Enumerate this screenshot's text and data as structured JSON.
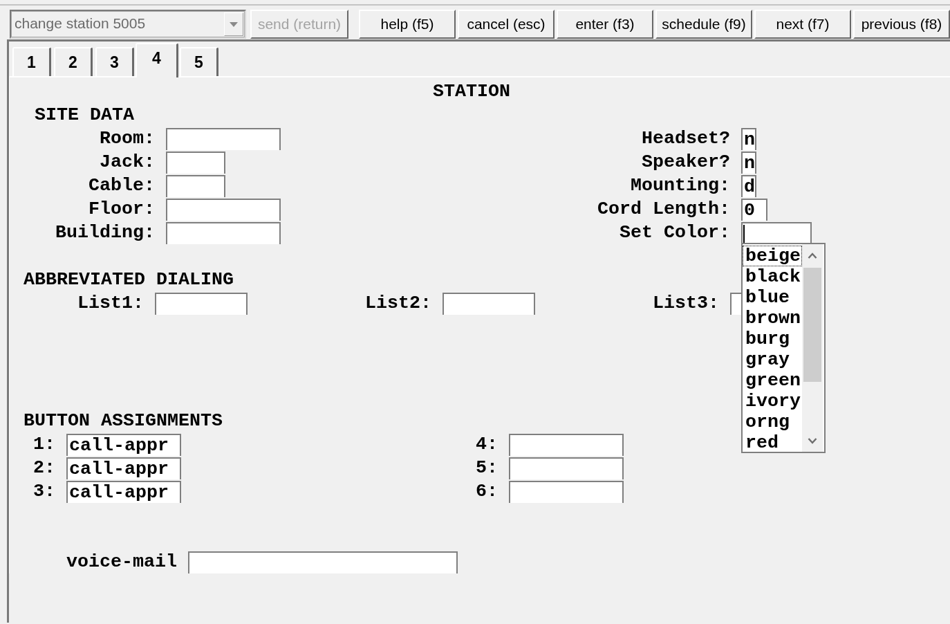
{
  "command_bar": {
    "command": "change station 5005",
    "buttons": [
      {
        "label": "send (return)",
        "disabled": true
      },
      {
        "label": "help (f5)",
        "disabled": false
      },
      {
        "label": "cancel (esc)",
        "disabled": false
      },
      {
        "label": "enter (f3)",
        "disabled": false
      },
      {
        "label": "schedule (f9)",
        "disabled": false
      },
      {
        "label": "next (f7)",
        "disabled": false
      },
      {
        "label": "previous (f8)",
        "disabled": false
      }
    ]
  },
  "tabs": [
    {
      "label": "1",
      "selected": false
    },
    {
      "label": "2",
      "selected": false
    },
    {
      "label": "3",
      "selected": false
    },
    {
      "label": "4",
      "selected": true
    },
    {
      "label": "5",
      "selected": false
    }
  ],
  "form": {
    "title": "STATION",
    "site_data": {
      "heading": "SITE DATA",
      "left_fields": [
        {
          "label": "Room:"
        },
        {
          "label": "Jack:"
        },
        {
          "label": "Cable:"
        },
        {
          "label": "Floor:"
        },
        {
          "label": "Building:"
        }
      ],
      "right_fields": [
        {
          "label": "Headset?",
          "value": "n",
          "focused": false
        },
        {
          "label": "Speaker?",
          "value": "n",
          "focused": false
        },
        {
          "label": "Mounting:",
          "value": "d",
          "focused": false
        },
        {
          "label": "Cord Length:",
          "value": "0",
          "focused": false
        },
        {
          "label": "Set Color:",
          "focused": true,
          "options": [
            {
              "label": "beige",
              "selected": true
            },
            {
              "label": "black",
              "selected": false
            },
            {
              "label": "blue",
              "selected": false
            },
            {
              "label": "brown",
              "selected": false
            },
            {
              "label": "burg",
              "selected": false
            },
            {
              "label": "gray",
              "selected": false
            },
            {
              "label": "green",
              "selected": false
            },
            {
              "label": "ivory",
              "selected": false
            },
            {
              "label": "orng",
              "selected": false
            },
            {
              "label": "red",
              "selected": false
            }
          ]
        }
      ]
    },
    "abbreviated_dialing": {
      "heading": "ABBREVIATED DIALING",
      "lists": [
        {
          "label": "List1:"
        },
        {
          "label": "List2:"
        },
        {
          "label": "List3:"
        }
      ]
    },
    "button_assignments": {
      "heading": "BUTTON ASSIGNMENTS",
      "left": [
        {
          "label": "1:",
          "value": "call-appr"
        },
        {
          "label": "2:",
          "value": "call-appr"
        },
        {
          "label": "3:",
          "value": "call-appr"
        }
      ],
      "right": [
        {
          "label": "4:"
        },
        {
          "label": "5:"
        },
        {
          "label": "6:"
        }
      ]
    },
    "voice_mail": {
      "label": "voice-mail"
    }
  }
}
